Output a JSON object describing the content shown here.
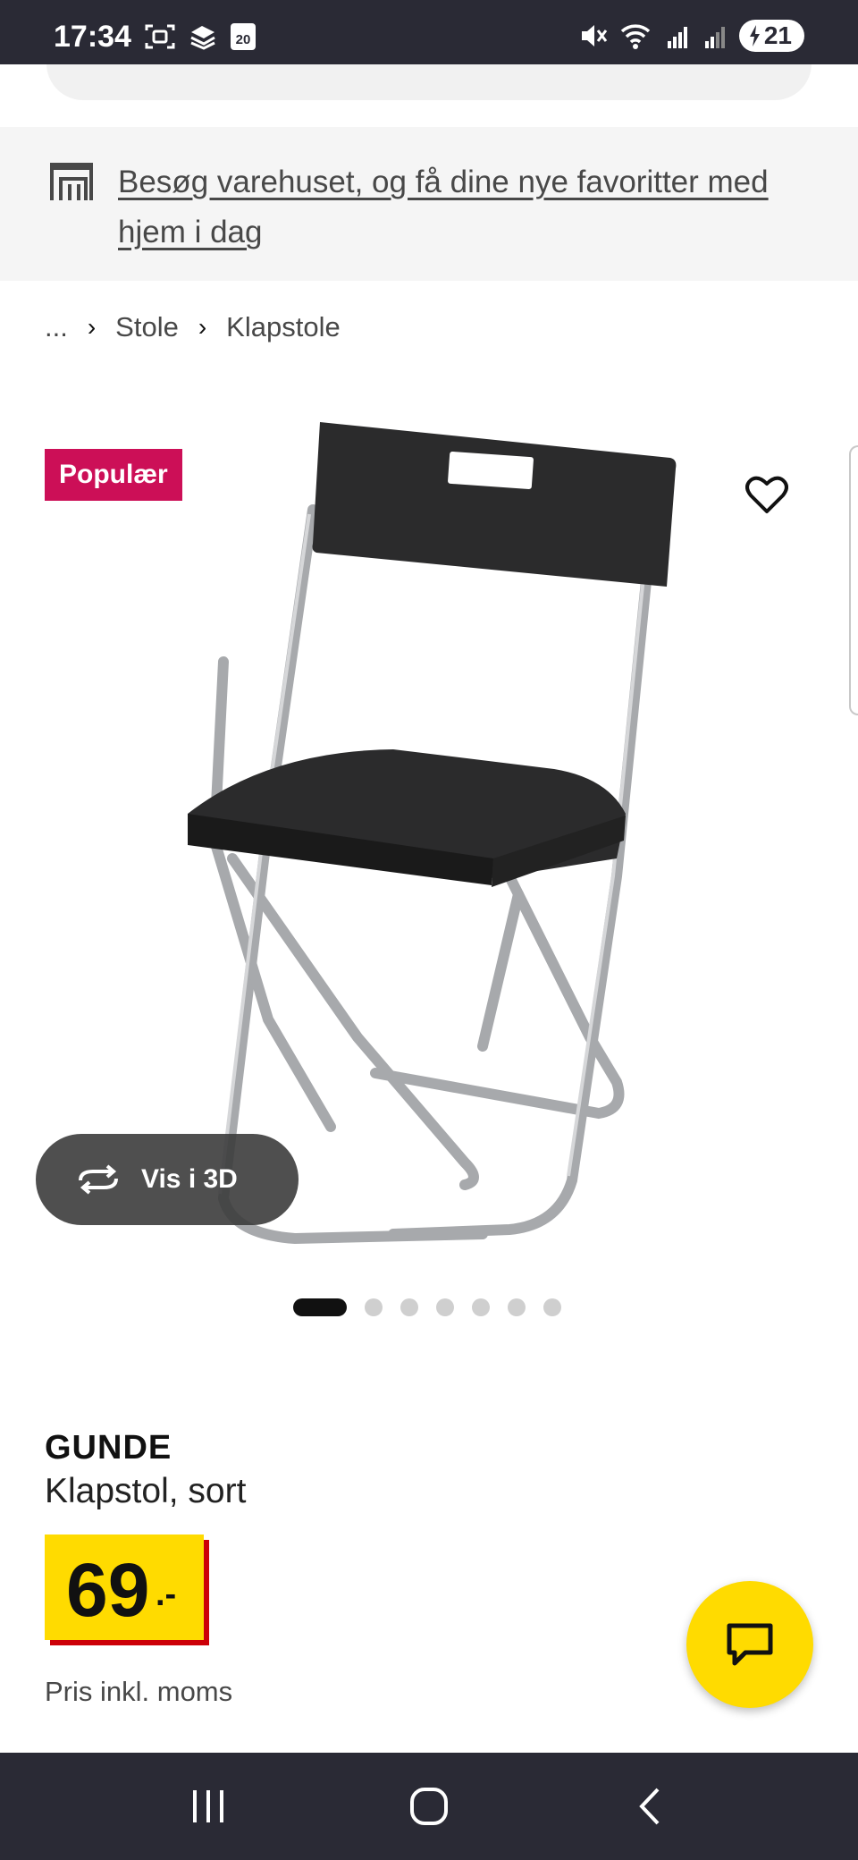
{
  "status_bar": {
    "time": "17:34",
    "calendar_day": "20",
    "battery_level": "21",
    "icons": [
      "screenshot-icon",
      "layers-icon",
      "calendar-icon",
      "mute-icon",
      "wifi-icon",
      "signal-r-icon",
      "signal-icon",
      "battery-charging-icon"
    ]
  },
  "store_banner": {
    "icon": "store-icon",
    "link_text": "Besøg varehuset, og få dine nye favoritter med hjem i dag"
  },
  "breadcrumb": {
    "items": [
      "...",
      "Stole",
      "Klapstole"
    ]
  },
  "media": {
    "badge": "Populær",
    "view_3d_label": "Vis i 3D",
    "image_count": 7,
    "active_index": 0
  },
  "product": {
    "name": "GUNDE",
    "description": "Klapstol, sort",
    "price_integer": "69",
    "price_suffix": ".-",
    "price_note": "Pris inkl. moms"
  },
  "colors": {
    "status_bar": "#2a2a35",
    "badge": "#cc0f57",
    "price_yellow": "#ffdb00",
    "price_shadow": "#cc0008",
    "chat_fab": "#ffdb00"
  }
}
